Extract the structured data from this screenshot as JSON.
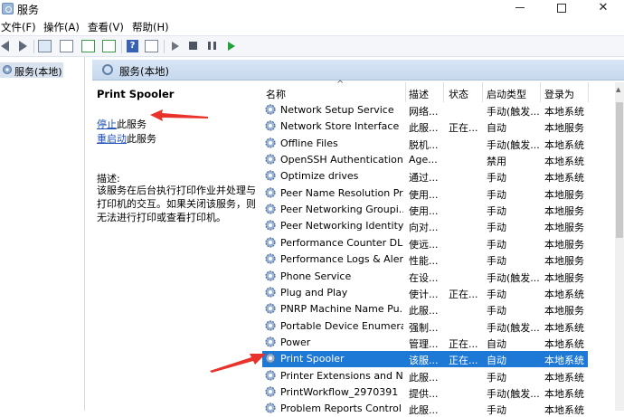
{
  "window": {
    "title": "服务"
  },
  "menu": {
    "items": [
      "文件(F)",
      "操作(A)",
      "查看(V)",
      "帮助(H)"
    ]
  },
  "tree": {
    "root_label": "服务(本地)"
  },
  "panel": {
    "header": "服务(本地)"
  },
  "description": {
    "service_name": "Print Spooler",
    "stop_link": "停止",
    "stop_suffix": "此服务",
    "restart_link": "重启动",
    "restart_suffix": "此服务",
    "desc_label": "描述:",
    "desc_text": "该服务在后台执行打印作业并处理与打印机的交互。如果关闭该服务，则无法进行打印或查看打印机。"
  },
  "table": {
    "columns": [
      "名称",
      "描述",
      "状态",
      "启动类型",
      "登录为"
    ],
    "rows": [
      {
        "name": "Network Setup Service",
        "desc": "网络...",
        "status": "",
        "startup": "手动(触发...",
        "logon": "本地系统"
      },
      {
        "name": "Network Store Interface ...",
        "desc": "此服...",
        "status": "正在...",
        "startup": "自动",
        "logon": "本地服务"
      },
      {
        "name": "Offline Files",
        "desc": "脱机...",
        "status": "",
        "startup": "手动(触发...",
        "logon": "本地系统"
      },
      {
        "name": "OpenSSH Authentication ...",
        "desc": "Age...",
        "status": "",
        "startup": "禁用",
        "logon": "本地系统"
      },
      {
        "name": "Optimize drives",
        "desc": "通过...",
        "status": "",
        "startup": "手动",
        "logon": "本地系统"
      },
      {
        "name": "Peer Name Resolution Pr...",
        "desc": "使用...",
        "status": "",
        "startup": "手动",
        "logon": "本地服务"
      },
      {
        "name": "Peer Networking Groupi...",
        "desc": "使用...",
        "status": "",
        "startup": "手动",
        "logon": "本地服务"
      },
      {
        "name": "Peer Networking Identity...",
        "desc": "向对...",
        "status": "",
        "startup": "手动",
        "logon": "本地服务"
      },
      {
        "name": "Performance Counter DL...",
        "desc": "使远...",
        "status": "",
        "startup": "手动",
        "logon": "本地服务"
      },
      {
        "name": "Performance Logs & Aler...",
        "desc": "性能...",
        "status": "",
        "startup": "手动",
        "logon": "本地服务"
      },
      {
        "name": "Phone Service",
        "desc": "在设...",
        "status": "",
        "startup": "手动(触发...",
        "logon": "本地服务"
      },
      {
        "name": "Plug and Play",
        "desc": "使计...",
        "status": "正在...",
        "startup": "手动",
        "logon": "本地系统"
      },
      {
        "name": "PNRP Machine Name Pu...",
        "desc": "此服...",
        "status": "",
        "startup": "手动",
        "logon": "本地服务"
      },
      {
        "name": "Portable Device Enumera...",
        "desc": "强制...",
        "status": "",
        "startup": "手动(触发...",
        "logon": "本地系统"
      },
      {
        "name": "Power",
        "desc": "管理...",
        "status": "正在...",
        "startup": "自动",
        "logon": "本地系统"
      },
      {
        "name": "Print Spooler",
        "desc": "该服...",
        "status": "正在...",
        "startup": "自动",
        "logon": "本地系统",
        "selected": true
      },
      {
        "name": "Printer Extensions and N...",
        "desc": "此服...",
        "status": "",
        "startup": "手动",
        "logon": "本地系统"
      },
      {
        "name": "PrintWorkflow_2970391",
        "desc": "提供...",
        "status": "",
        "startup": "手动(触发...",
        "logon": "本地系统"
      },
      {
        "name": "Problem Reports Control ...",
        "desc": "此服...",
        "status": "",
        "startup": "手动",
        "logon": "本地系统"
      }
    ]
  },
  "colors": {
    "selected_row": "#1e78d6",
    "link": "#1f4fb8",
    "annotation_arrow": "#e8322a"
  },
  "icons": [
    "app-icon",
    "back-icon",
    "forward-icon",
    "show-tree-icon",
    "properties-icon",
    "refresh-icon",
    "export-icon",
    "help-icon",
    "console-icon",
    "start-icon",
    "stop-icon",
    "pause-icon",
    "restart-icon",
    "gear-icon",
    "search-icon"
  ]
}
